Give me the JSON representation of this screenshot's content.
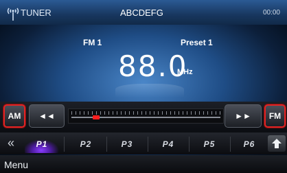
{
  "header": {
    "source": "TUNER",
    "station_name": "ABCDEFG",
    "clock": "00:00"
  },
  "tuner": {
    "band": "FM 1",
    "preset": "Preset 1",
    "frequency": "88.0",
    "unit": "MHz"
  },
  "controls": {
    "am": "AM",
    "fm": "FM",
    "seek_back": "◄◄",
    "seek_forward": "►►"
  },
  "slider": {
    "position_fraction": 0.15
  },
  "presets": [
    "P1",
    "P2",
    "P3",
    "P4",
    "P5",
    "P6"
  ],
  "nav": {
    "prev": "«",
    "menu": "Menu"
  },
  "accent": {
    "highlight": "#e02424",
    "active_preset": "#8a3cff"
  }
}
